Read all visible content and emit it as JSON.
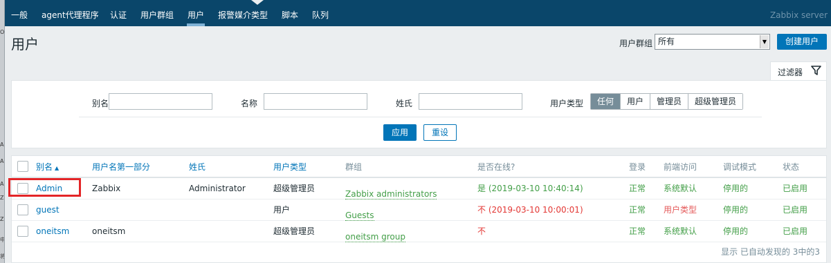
{
  "nav": {
    "items": [
      "一般",
      "agent代理程序",
      "认证",
      "用户群组",
      "用户",
      "报警媒介类型",
      "脚本",
      "队列"
    ],
    "active": "用户",
    "brand": "Zabbix server"
  },
  "header": {
    "title": "用户",
    "group_label": "用户群组",
    "group_value": "所有",
    "create_button": "创建用户"
  },
  "filter": {
    "tab_label": "过滤器",
    "alias_label": "别名",
    "name_label": "名称",
    "surname_label": "姓氏",
    "type_label": "用户类型",
    "type_options": [
      "任何",
      "用户",
      "管理员",
      "超级管理员"
    ],
    "type_selected": "任何",
    "apply": "应用",
    "reset": "重设"
  },
  "table": {
    "columns": [
      "别名",
      "用户名第一部分",
      "姓氏",
      "用户类型",
      "群组",
      "是否在线?",
      "登录",
      "前端访问",
      "调试模式",
      "状态"
    ],
    "rows": [
      {
        "alias": "Admin",
        "name": "Zabbix",
        "surname": "Administrator",
        "type": "超级管理员",
        "groups": "Zabbix administrators",
        "online": "是 (2019-03-10 10:40:14)",
        "login": "正常",
        "frontend": "系统默认",
        "debug": "停用的",
        "status": "已启用"
      },
      {
        "alias": "guest",
        "name": "",
        "surname": "",
        "type": "用户",
        "groups": "Guests",
        "online": "不 (2019-03-10 10:00:01)",
        "login": "正常",
        "frontend": "用户类型",
        "debug": "停用的",
        "status": "已启用"
      },
      {
        "alias": "oneitsm",
        "name": "oneitsm",
        "surname": "",
        "type": "超级管理员",
        "groups": "oneitsm group",
        "online": "不",
        "login": "正常",
        "frontend": "系统默认",
        "debug": "停用的",
        "status": "已启用"
      }
    ],
    "footer": "显示 已自动发现的 3中的3"
  },
  "left_strip_glyphs": [
    "O",
    "A",
    "A",
    "A",
    "Z",
    "Z",
    "中",
    "将"
  ],
  "colors": {
    "nav_bg": "#0a466a",
    "primary": "#0275b8",
    "green": "#429e47",
    "red": "#e33734",
    "highlight_box": "#e32427"
  }
}
